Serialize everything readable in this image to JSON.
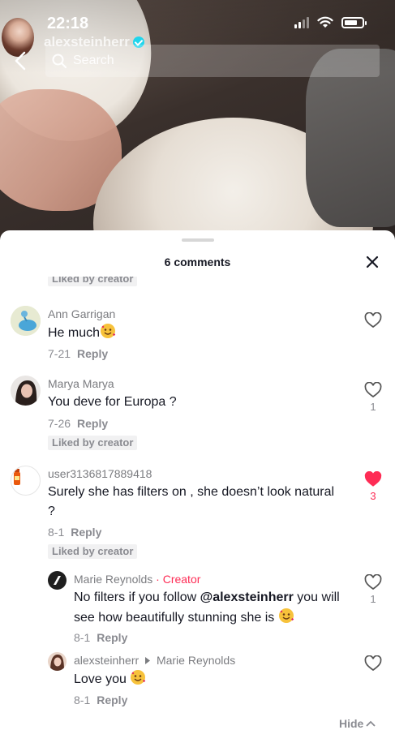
{
  "status": {
    "time": "22:18"
  },
  "header": {
    "username": "alexsteinherr",
    "search_placeholder": "Search"
  },
  "sheet": {
    "title": "6 comments",
    "top_liked_chip": "Liked by creator",
    "hide_label": "Hide"
  },
  "comments": [
    {
      "username": "Ann Garrigan",
      "text": "He much",
      "date": "7-21",
      "reply_label": "Reply",
      "likes": ""
    },
    {
      "username": "Marya Marya",
      "text": "You deve for Europa ?",
      "date": "7-26",
      "reply_label": "Reply",
      "likes": "1",
      "liked_by_creator": "Liked by creator"
    },
    {
      "username": "user3136817889418",
      "text": "Surely she has filters on , she doesn’t look natural ?",
      "date": "8-1",
      "reply_label": "Reply",
      "likes": "3",
      "liked_by_creator": "Liked by creator",
      "liked": true
    }
  ],
  "replies": [
    {
      "username": "Marie Reynolds",
      "creator_tag": "· Creator",
      "text_before": "No filters if you follow ",
      "mention": "@alexsteinherr",
      "text_after": " you will see how beautifully stunning she is",
      "date": "8-1",
      "reply_label": "Reply",
      "likes": "1"
    },
    {
      "username": "alexsteinherr",
      "reply_to": "Marie Reynolds",
      "text": "Love you",
      "date": "8-1",
      "reply_label": "Reply",
      "likes": ""
    }
  ],
  "colors": {
    "accent_red": "#fe2c55",
    "verified_blue": "#20d5ec",
    "text_primary": "#161823",
    "text_secondary": "#8a8b91"
  },
  "icons": {
    "back": "chevron-left-icon",
    "search": "search-icon",
    "close": "close-icon",
    "heart": "heart-icon",
    "emoji": "smiling-face-with-hearts-emoji"
  }
}
